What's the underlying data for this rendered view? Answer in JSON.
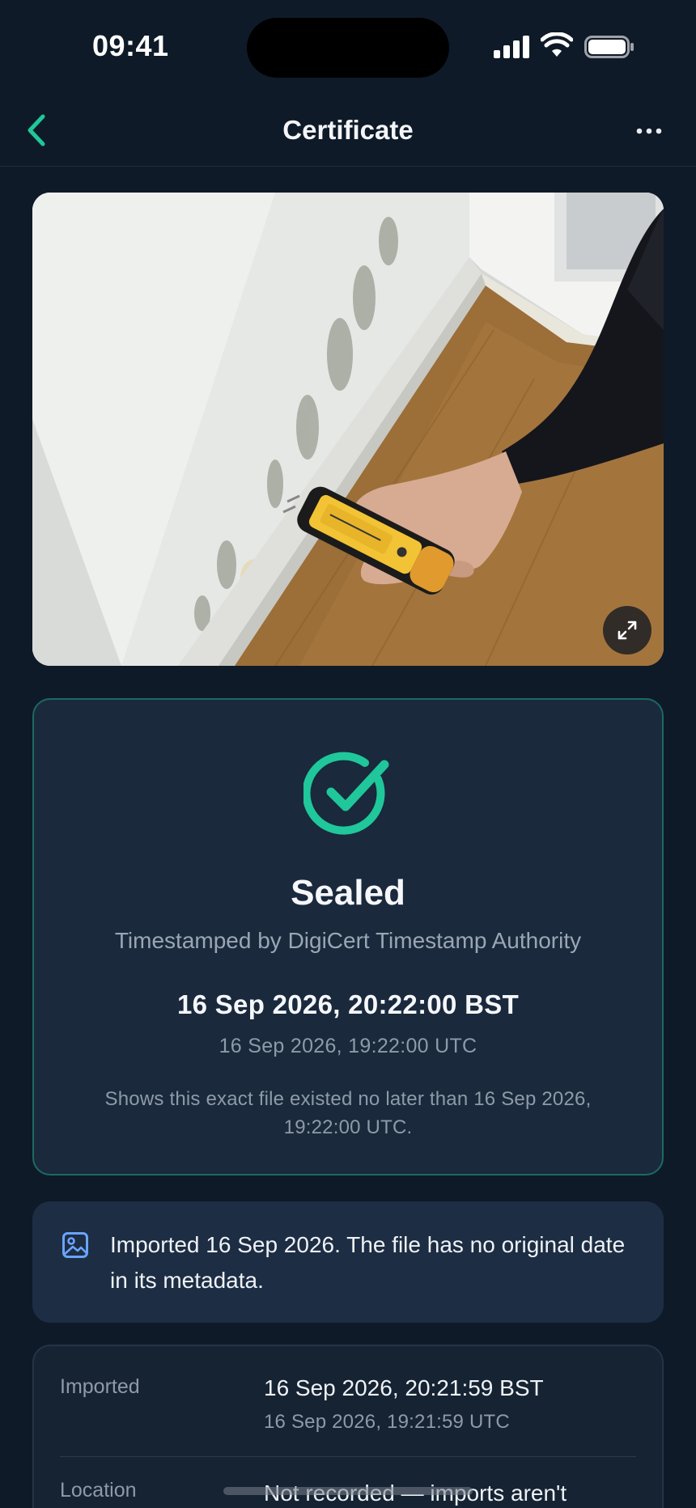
{
  "status_bar": {
    "time": "09:41",
    "signal_icon": "cellular-signal-icon",
    "wifi_icon": "wifi-icon",
    "battery_icon": "battery-icon"
  },
  "nav": {
    "title": "Certificate",
    "back_icon": "chevron-left-icon",
    "more_icon": "ellipsis-icon"
  },
  "photo": {
    "expand_icon": "expand-arrows-icon"
  },
  "seal": {
    "icon": "check-circle-icon",
    "title": "Sealed",
    "subtitle": "Timestamped by DigiCert Timestamp Authority",
    "date_local": "16 Sep 2026, 20:22:00 BST",
    "date_utc": "16 Sep 2026, 19:22:00 UTC",
    "note": "Shows this exact file existed no later than 16 Sep 2026, 19:22:00 UTC."
  },
  "info": {
    "icon": "image-icon",
    "text": "Imported 16 Sep 2026. The file has no original date in its metadata."
  },
  "details": {
    "rows": [
      {
        "label": "Imported",
        "value": "16 Sep 2026, 20:21:59 BST",
        "sub": "16 Sep 2026, 19:21:59 UTC"
      },
      {
        "label": "Location",
        "value": "Not recorded — imports aren't"
      }
    ]
  },
  "colors": {
    "background": "#0f1a28",
    "card": "#1a293c",
    "accent_green": "#1fc79a",
    "card_border_green": "#1b6a62",
    "info_icon_blue": "#6aa4ff"
  }
}
